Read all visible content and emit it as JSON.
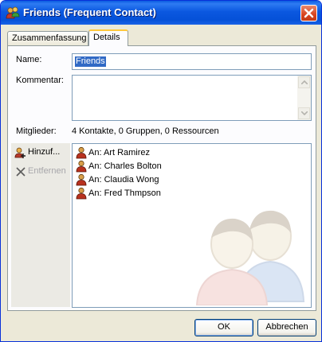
{
  "window": {
    "title": "Friends (Frequent Contact)",
    "icon": "group-contact-icon",
    "close_icon": "close-icon"
  },
  "tabs": [
    {
      "label": "Zusammenfassung",
      "active": false
    },
    {
      "label": "Details",
      "active": true
    }
  ],
  "form": {
    "name_label": "Name:",
    "name_value": "Friends",
    "comment_label": "Kommentar:",
    "comment_value": "",
    "members_label": "Mitglieder:",
    "members_summary": "4 Kontakte, 0 Gruppen, 0 Ressourcen"
  },
  "actions": {
    "add_label": "Hinzuf...",
    "add_icon": "add-contact-icon",
    "remove_label": "Entfernen",
    "remove_icon": "delete-x-icon",
    "remove_enabled": false
  },
  "members": [
    {
      "label": "An: Art Ramirez",
      "icon": "person-icon"
    },
    {
      "label": "An: Charles Bolton",
      "icon": "person-icon"
    },
    {
      "label": "An: Claudia Wong",
      "icon": "person-icon"
    },
    {
      "label": "An: Fred Thmpson",
      "icon": "person-icon"
    }
  ],
  "buttons": {
    "ok_label": "OK",
    "cancel_label": "Abbrechen"
  },
  "colors": {
    "title_bar": "#0b58e0",
    "close_button": "#d8431f",
    "selection": "#316ac5",
    "active_tab_accent": "#ffc83c"
  }
}
